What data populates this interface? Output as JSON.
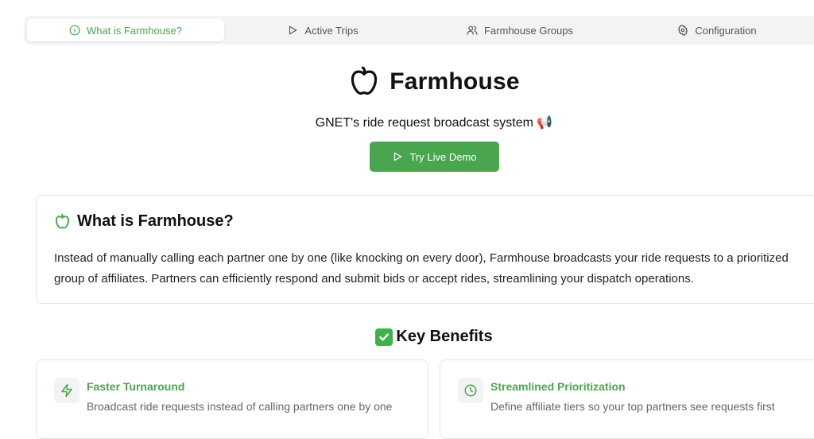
{
  "tabs": [
    {
      "label": "What is Farmhouse?",
      "icon": "info-icon",
      "active": true
    },
    {
      "label": "Active Trips",
      "icon": "play-icon",
      "active": false
    },
    {
      "label": "Farmhouse Groups",
      "icon": "users-icon",
      "active": false
    },
    {
      "label": "Configuration",
      "icon": "gear-icon",
      "active": false
    }
  ],
  "hero": {
    "title": "Farmhouse",
    "logo_icon": "apple-icon",
    "tagline": "GNET's ride request broadcast system",
    "tagline_emoji": "📢",
    "demo_button_label": "Try Live Demo",
    "demo_button_icon": "play-icon"
  },
  "about": {
    "title": "What is Farmhouse?",
    "icon": "apple-icon",
    "body": "Instead of manually calling each partner one by one (like knocking on every door), Farmhouse broadcasts your ride requests to a prioritized group of affiliates. Partners can efficiently respond and submit bids or accept rides, streamlining your dispatch operations."
  },
  "benefits": {
    "title": "Key Benefits",
    "title_icon": "check-box-icon",
    "items": [
      {
        "title": "Faster Turnaround",
        "desc": "Broadcast ride requests instead of calling partners one by one",
        "icon": "zap-icon"
      },
      {
        "title": "Streamlined Prioritization",
        "desc": "Define affiliate tiers so your top partners see requests first",
        "icon": "clock-icon"
      }
    ]
  },
  "colors": {
    "accent": "#4aa54f",
    "tab_bar_bg": "#f3f3f3",
    "card_border": "#e3e3e3"
  }
}
